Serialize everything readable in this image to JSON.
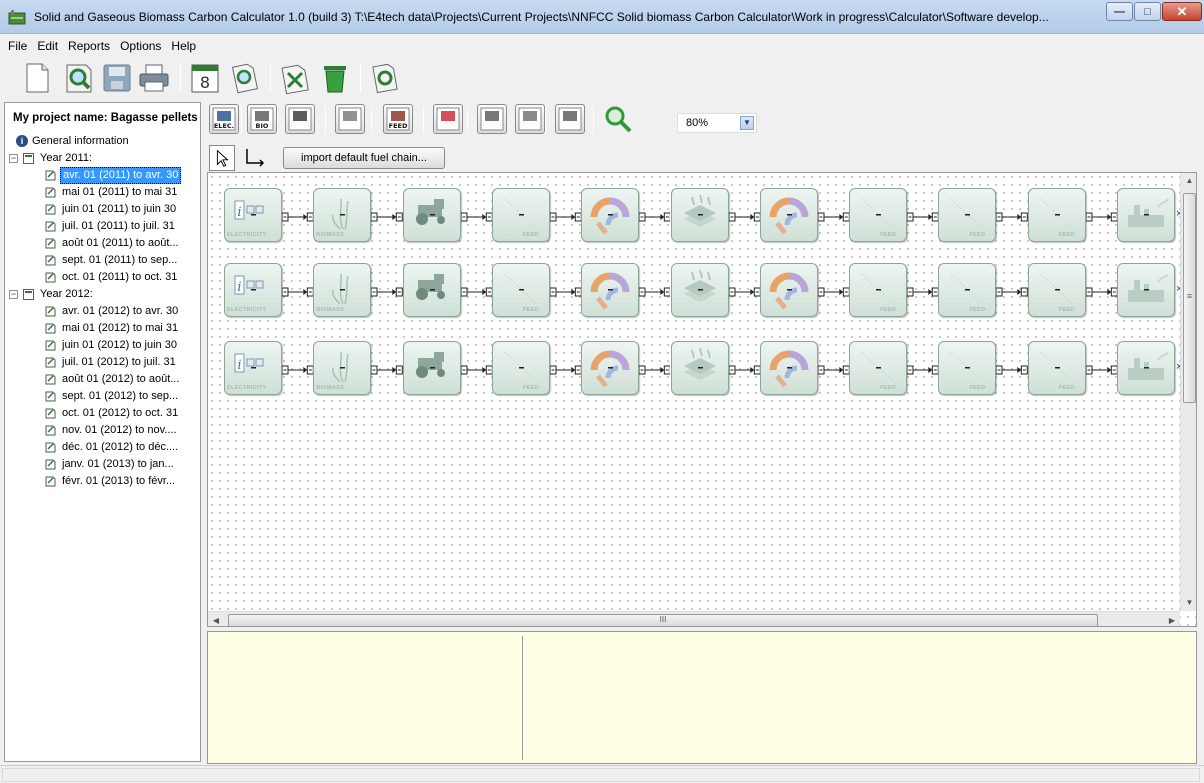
{
  "window": {
    "title": "Solid and Gaseous Biomass Carbon Calculator 1.0 (build 3) T:\\E4tech data\\Projects\\Current Projects\\NNFCC Solid biomass Carbon Calculator\\Work in progress\\Calculator\\Software develop...",
    "minimize_label": "—",
    "maximize_label": "□",
    "close_label": "✕"
  },
  "menu": [
    "File",
    "Edit",
    "Reports",
    "Options",
    "Help"
  ],
  "toolbar": {
    "buttons": [
      "new-document-icon",
      "open-search-icon",
      "save-icon",
      "print-icon",
      "calendar-icon",
      "edit-search-icon",
      "delete-page-icon",
      "trash-icon",
      "refresh-document-icon"
    ]
  },
  "project": {
    "name": "My project name: Bagasse pellets"
  },
  "tree": {
    "general": "General information",
    "years": [
      {
        "label": "Year 2011:",
        "periods": [
          "avr. 01 (2011) to avr. 30",
          "mai 01 (2011) to mai 31",
          "juin 01 (2011) to juin 30",
          "juil. 01 (2011) to juil. 31",
          "août 01 (2011) to août...",
          "sept. 01 (2011) to sep...",
          "oct. 01 (2011) to oct. 31"
        ]
      },
      {
        "label": "Year 2012:",
        "periods": [
          "avr. 01 (2012) to avr. 30",
          "mai 01 (2012) to mai 31",
          "juin 01 (2012) to juin 30",
          "juil. 01 (2012) to juil. 31",
          "août 01 (2012) to août...",
          "sept. 01 (2012) to sep...",
          "oct. 01 (2012) to oct. 31",
          "nov. 01 (2012) to nov....",
          "déc. 01 (2012) to déc....",
          "janv. 01 (2013) to jan...",
          "févr. 01 (2013) to févr..."
        ]
      }
    ],
    "selected": "avr. 01 (2011) to avr. 30"
  },
  "diagram_toolbar": {
    "buttons": [
      {
        "icon": "electricity-icon",
        "label": "ELEC."
      },
      {
        "icon": "biomass-icon",
        "label": "BIO"
      },
      {
        "icon": "tractor-icon",
        "label": ""
      },
      {
        "icon": "drying-icon",
        "label": ""
      },
      {
        "icon": "feed-icon",
        "label": "FEED"
      },
      {
        "icon": "conversion-icon",
        "label": ""
      },
      {
        "icon": "transport-icon",
        "label": ""
      },
      {
        "icon": "storage-icon",
        "label": ""
      },
      {
        "icon": "plant-icon",
        "label": ""
      },
      {
        "icon": "zoom-icon",
        "label": ""
      }
    ],
    "zoom": "80%"
  },
  "tool_row": {
    "import_label": "import default fuel chain..."
  },
  "canvas": {
    "node_labels": {
      "electricity": "ELECTRICITY",
      "biomass": "BIOMASS",
      "feed": "FEED"
    },
    "chain_sequence": [
      "electricity",
      "biomass",
      "tractor",
      "feed",
      "conversion",
      "drying",
      "conversion",
      "feed",
      "feed",
      "feed",
      "plant"
    ],
    "row_count": 3
  },
  "scroll": {
    "h_grip": "III",
    "v_grip": "≡"
  }
}
